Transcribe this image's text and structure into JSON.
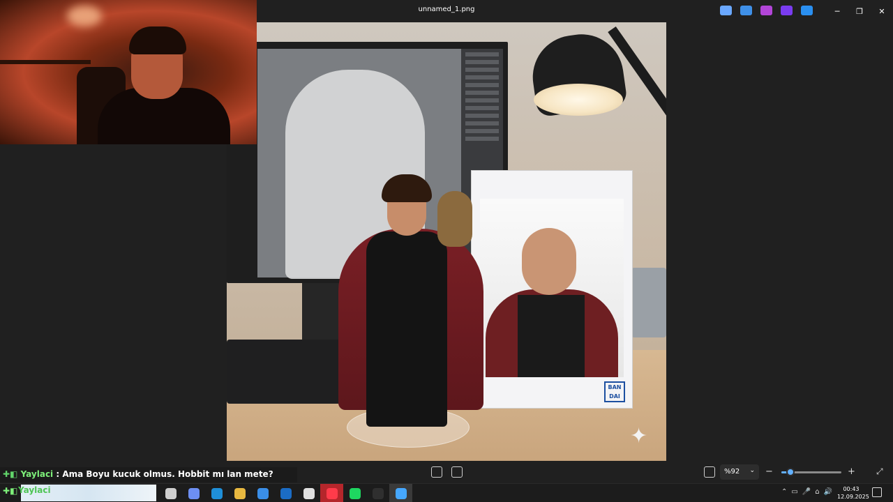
{
  "window": {
    "title": "unnamed_1.png",
    "apps": [
      {
        "name": "copilot-icon",
        "color": "#6aa8ff"
      },
      {
        "name": "paint-icon",
        "color": "#3f90e8"
      },
      {
        "name": "clipchamp-icon",
        "color": "#b245d8"
      },
      {
        "name": "video-icon",
        "color": "#7a3cf0"
      },
      {
        "name": "onedrive-icon",
        "color": "#2a8ff0"
      }
    ],
    "controls": {
      "minimize": "─",
      "maximize": "❐",
      "close": "✕"
    }
  },
  "photo_box": {
    "logo": "BAN DAI"
  },
  "viewer": {
    "zoom_value": "%92",
    "zoom_caret": "⌄",
    "zoom_out": "−",
    "zoom_in": "+",
    "zoom_fraction": 0.15,
    "fullscreen": "⤢"
  },
  "chat": {
    "badge": "✚◧",
    "user": "Yaylaci",
    "separator": " : ",
    "message": "Ama Boyu kucuk olmus. Hobbit mı lan mete?"
  },
  "taskbar": {
    "badge_user": "✚◧",
    "banner_user": "Yaylaci",
    "icons": [
      {
        "name": "task-view-icon",
        "color": "#cfcfcf"
      },
      {
        "name": "copilot-icon",
        "color": "#6d8ff2"
      },
      {
        "name": "edge-icon",
        "color": "#1f8fd8"
      },
      {
        "name": "file-explorer-icon",
        "color": "#e8b840"
      },
      {
        "name": "store-icon",
        "color": "#3a8ee8"
      },
      {
        "name": "outlook-icon",
        "color": "#1b6cc5"
      },
      {
        "name": "performance-icon",
        "color": "#e0e0e0"
      },
      {
        "name": "opera-icon",
        "color": "#ff3b4a"
      },
      {
        "name": "spotify-icon",
        "color": "#1ed760"
      },
      {
        "name": "terminal-icon",
        "color": "#2f2f2f"
      },
      {
        "name": "photos-icon",
        "color": "#46a8ff"
      }
    ],
    "tray": [
      "⌃",
      "▭",
      "🎤",
      "⌂",
      "🔊"
    ],
    "time": "00:43",
    "date": "12.09.2025"
  }
}
